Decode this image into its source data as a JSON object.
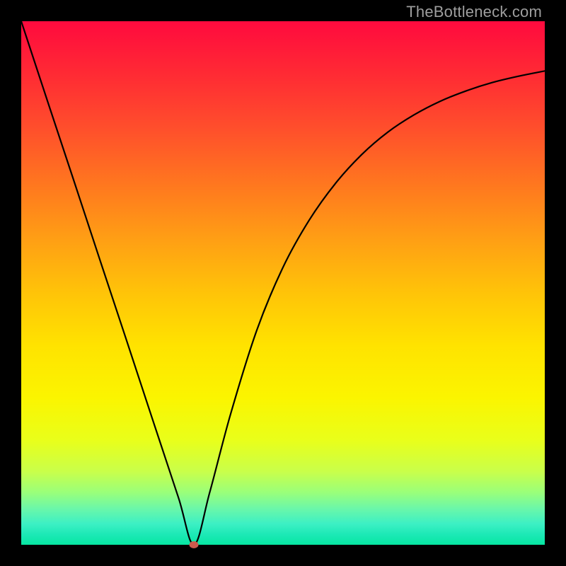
{
  "watermark": "TheBottleneck.com",
  "gradient_colors": {
    "top": "#ff0a3e",
    "mid": "#ffe300",
    "bottom": "#06e6a2"
  },
  "chart_data": {
    "type": "line",
    "title": "",
    "xlabel": "",
    "ylabel": "",
    "xlim": [
      0,
      100
    ],
    "ylim": [
      0,
      100
    ],
    "grid": false,
    "annotations": [
      {
        "name": "minimum-point",
        "x": 33,
        "y": 0,
        "color": "#cc5a4d"
      }
    ],
    "series": [
      {
        "name": "bottleneck-curve",
        "color": "#000000",
        "x": [
          0,
          5,
          10,
          15,
          20,
          25,
          30,
          33,
          36,
          40,
          45,
          50,
          55,
          60,
          65,
          70,
          75,
          80,
          85,
          90,
          95,
          100
        ],
        "y": [
          100,
          84.8,
          69.7,
          54.5,
          39.4,
          24.2,
          9.1,
          0,
          10,
          25,
          41,
          53,
          62,
          69,
          74.5,
          78.8,
          82.1,
          84.7,
          86.7,
          88.3,
          89.5,
          90.5
        ]
      }
    ]
  }
}
